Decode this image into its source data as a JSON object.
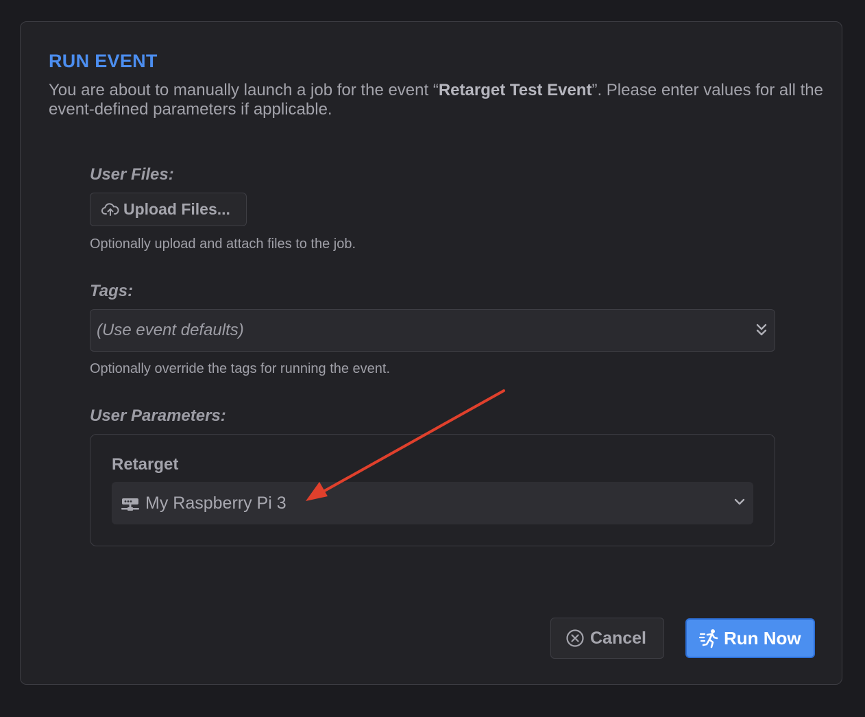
{
  "dialog": {
    "title": "RUN EVENT",
    "intro_before": "You are about to manually launch a job for the event “",
    "event_name": "Retarget Test Event",
    "intro_after": "”. Please enter values for all the event-defined parameters if applicable."
  },
  "user_files": {
    "label": "User Files:",
    "button_label": "Upload Files...",
    "button_icon": "cloud-upload-icon",
    "caption": "Optionally upload and attach files to the job."
  },
  "tags": {
    "label": "Tags:",
    "selected": "(Use event defaults)",
    "icon": "chevron-double-down-icon",
    "caption": "Optionally override the tags for running the event."
  },
  "user_parameters": {
    "label": "User Parameters:",
    "params": [
      {
        "name": "Retarget",
        "selected": "My Raspberry Pi 3",
        "icon": "server-icon"
      }
    ]
  },
  "actions": {
    "cancel_label": "Cancel",
    "cancel_icon": "close-circle-icon",
    "run_label": "Run Now",
    "run_icon": "run-fast-icon"
  },
  "colors": {
    "accent": "#4c8ef0",
    "annotation_arrow": "#e0402c"
  }
}
